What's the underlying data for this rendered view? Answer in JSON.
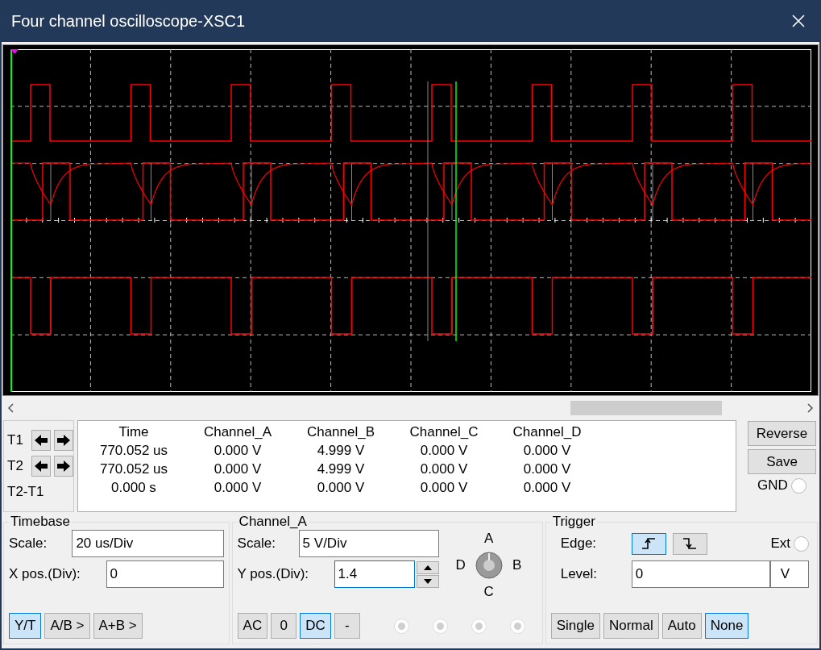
{
  "window": {
    "title": "Four channel oscilloscope-XSC1"
  },
  "cursors": [
    {
      "label": "T1",
      "kind": "arrows"
    },
    {
      "label": "T2",
      "kind": "arrows"
    },
    {
      "label": "T2-T1",
      "kind": "plain"
    }
  ],
  "readout": {
    "columns": [
      "Time",
      "Channel_A",
      "Channel_B",
      "Channel_C",
      "Channel_D"
    ],
    "rows": [
      [
        "770.052 us",
        "0.000 V",
        "4.999 V",
        "0.000 V",
        "0.000 V"
      ],
      [
        "770.052 us",
        "0.000 V",
        "4.999 V",
        "0.000 V",
        "0.000 V"
      ],
      [
        "0.000 s",
        "0.000 V",
        "0.000 V",
        "0.000 V",
        "0.000 V"
      ]
    ]
  },
  "side_buttons": [
    "Reverse",
    "Save"
  ],
  "gnd": {
    "label": "GND",
    "selected": false
  },
  "timebase": {
    "title": "Timebase",
    "scale_label": "Scale:",
    "scale": "20 us/Div",
    "xpos_label": "X pos.(Div):",
    "xpos": "0",
    "modes": [
      {
        "label": "Y/T",
        "selected": true
      },
      {
        "label": "A/B >",
        "selected": false
      },
      {
        "label": "A+B >",
        "selected": false
      }
    ]
  },
  "channel": {
    "title": "Channel_A",
    "scale_label": "Scale:",
    "scale": "5  V/Div",
    "ypos_label": "Y pos.(Div):",
    "ypos": "1.4",
    "knob": {
      "top": "A",
      "left": "D",
      "right": "B",
      "bottom": "C"
    },
    "coupling": [
      {
        "label": "AC",
        "selected": false
      },
      {
        "label": "0",
        "selected": false
      },
      {
        "label": "DC",
        "selected": true
      },
      {
        "label": "-",
        "selected": false
      }
    ],
    "options": [
      {
        "disabled": true
      },
      {
        "disabled": true
      },
      {
        "disabled": true
      },
      {
        "disabled": true
      }
    ]
  },
  "trigger": {
    "title": "Trigger",
    "edge_label": "Edge:",
    "edges": [
      {
        "kind": "rising",
        "selected": true
      },
      {
        "kind": "falling",
        "selected": false
      }
    ],
    "ext": {
      "label": "Ext",
      "selected": false
    },
    "level_label": "Level:",
    "level": "0",
    "unit": "V",
    "modes": [
      {
        "label": "Single",
        "selected": false
      },
      {
        "label": "Normal",
        "selected": false
      },
      {
        "label": "Auto",
        "selected": false
      },
      {
        "label": "None",
        "selected": true
      }
    ]
  }
}
